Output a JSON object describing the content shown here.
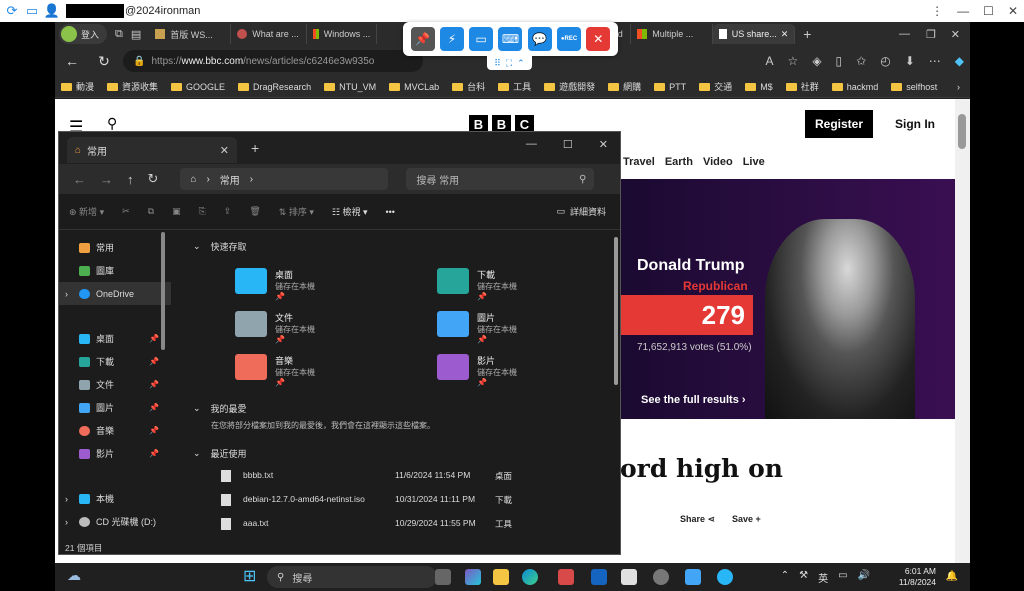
{
  "rd_bar": {
    "user_suffix": "@2024ironman"
  },
  "tabs": [
    {
      "label": "登入"
    },
    {
      "label": "首版 WS..."
    },
    {
      "label": "What are ..."
    },
    {
      "label": "Windows ..."
    },
    {
      "label": "...oard"
    },
    {
      "label": "Multiple ..."
    },
    {
      "label": "US share..."
    }
  ],
  "address": {
    "url_prefix": "https://",
    "url_host": "www.bbc.com",
    "url_path": "/news/articles/c6246e3w935o"
  },
  "bookmarks": [
    "動漫",
    "資源收集",
    "GOOGLE",
    "DragResearch",
    "NTU_VM",
    "MVCLab",
    "台科",
    "工具",
    "遊戲開發",
    "網購",
    "PTT",
    "交通",
    "M$",
    "社群",
    "hackmd",
    "selfhost"
  ],
  "bbc": {
    "logo": [
      "B",
      "B",
      "C"
    ],
    "register": "Register",
    "signin": "Sign In",
    "nav": [
      "Travel",
      "Earth",
      "Video",
      "Live"
    ],
    "candidate_name": "Donald Trump",
    "candidate_party": "Republican",
    "electoral_votes": "279",
    "popular_votes": "71,652,913 votes (51.0%)",
    "full_results": "See the full results",
    "headline": "ord high on",
    "share": "Share",
    "save": "Save"
  },
  "explorer": {
    "tab_title": "常用",
    "path": "常用",
    "search_placeholder": "搜尋 常用",
    "cmd_new": "新增",
    "cmd_sort": "排序",
    "cmd_view": "檢視",
    "cmd_details": "詳細資料",
    "sidebar": [
      {
        "label": "常用",
        "color": "#f0a040"
      },
      {
        "label": "圖庫",
        "color": "#4caf50"
      },
      {
        "label": "OneDrive",
        "color": "#2196f3"
      },
      {
        "label": "桌面",
        "color": "#29b6f6"
      },
      {
        "label": "下載",
        "color": "#26a69a"
      },
      {
        "label": "文件",
        "color": "#90a4ae"
      },
      {
        "label": "圖片",
        "color": "#42a5f5"
      },
      {
        "label": "音樂",
        "color": "#ef6c5a"
      },
      {
        "label": "影片",
        "color": "#9c5ccf"
      },
      {
        "label": "本機",
        "color": "#29b6f6"
      },
      {
        "label": "CD 光碟機 (D:)",
        "color": "#bbbbbb"
      }
    ],
    "quick_access_title": "快速存取",
    "quick_access": [
      {
        "name": "桌面",
        "sub": "儲存在本機",
        "color": "#29b6f6"
      },
      {
        "name": "下載",
        "sub": "儲存在本機",
        "color": "#26a69a"
      },
      {
        "name": "文件",
        "sub": "儲存在本機",
        "color": "#90a4ae"
      },
      {
        "name": "圖片",
        "sub": "儲存在本機",
        "color": "#42a5f5"
      },
      {
        "name": "音樂",
        "sub": "儲存在本機",
        "color": "#ef6c5a"
      },
      {
        "name": "影片",
        "sub": "儲存在本機",
        "color": "#9c5ccf"
      }
    ],
    "favorites_title": "我的最愛",
    "favorites_hint": "在您將部分檔案加到我的最愛後，我們會在這裡顯示這些檔案。",
    "recent_title": "最近使用",
    "recent": [
      {
        "name": "bbbb.txt",
        "date": "11/6/2024 11:54 PM",
        "loc": "桌面"
      },
      {
        "name": "debian-12.7.0-amd64-netinst.iso",
        "date": "10/31/2024 11:11 PM",
        "loc": "下載"
      },
      {
        "name": "aaa.txt",
        "date": "10/29/2024 11:55 PM",
        "loc": "工具"
      }
    ],
    "status": "21 個項目"
  },
  "taskbar": {
    "search": "搜尋",
    "ime": "英",
    "time": "6:01 AM",
    "date": "11/8/2024"
  }
}
